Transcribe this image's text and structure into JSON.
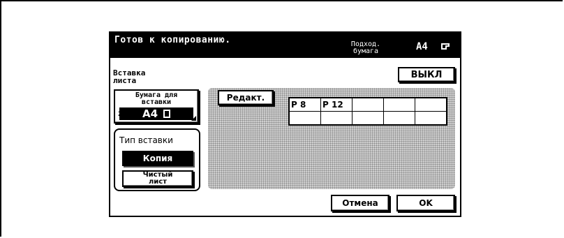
{
  "header": {
    "status": "Готов к копированию.",
    "paper_label": "Подход. бумага",
    "paper_size": "A4"
  },
  "function": {
    "title": "Вставка листа",
    "off_label": "ВЫКЛ"
  },
  "insert_paper": {
    "label": "Бумага для вставки",
    "value": "A4",
    "edge_mark": "2"
  },
  "insert_type": {
    "title": "Тип вставки",
    "options": [
      "Копия",
      "Чистый лист"
    ],
    "selected": "Копия"
  },
  "edit": {
    "button_label": "Редакт.",
    "pages": [
      [
        "P  8",
        "P 12",
        "",
        "",
        ""
      ],
      [
        "",
        "",
        "",
        "",
        ""
      ]
    ]
  },
  "footer": {
    "cancel_label": "Отмена",
    "ok_label": "OK"
  }
}
